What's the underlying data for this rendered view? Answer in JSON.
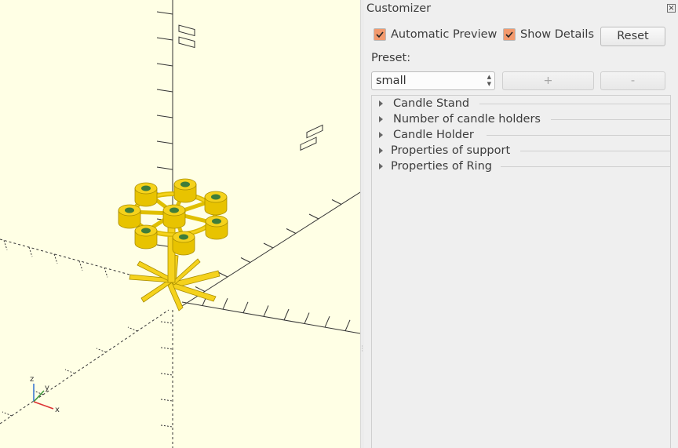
{
  "viewport": {
    "axis_labels": {
      "z": "z",
      "y": "y",
      "x": "x"
    }
  },
  "customizer": {
    "title": "Customizer",
    "auto_preview": {
      "label": "Automatic Preview",
      "checked": true
    },
    "show_details": {
      "label": "Show Details",
      "checked": true
    },
    "reset_label": "Reset",
    "preset_label": "Preset:",
    "preset_value": "small",
    "add_label": "+",
    "remove_label": "-",
    "groups": [
      {
        "label": "Candle Stand"
      },
      {
        "label": "Number of candle holders"
      },
      {
        "label": "Candle Holder"
      },
      {
        "label": "Properties of support"
      },
      {
        "label": "Properties of Ring"
      }
    ]
  },
  "colors": {
    "model": "#f5d21c",
    "background": "#ffffe5",
    "checkbox": "#f39a6e"
  }
}
